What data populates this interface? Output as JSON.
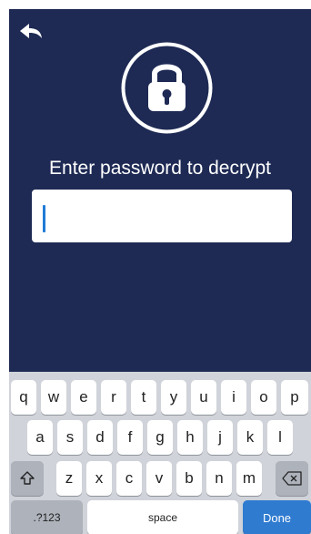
{
  "header": {
    "back_icon": "back-arrow-icon",
    "lock_icon": "lock-icon"
  },
  "prompt": "Enter password to decrypt",
  "password": {
    "value": "",
    "placeholder": ""
  },
  "keyboard": {
    "row1": [
      "q",
      "w",
      "e",
      "r",
      "t",
      "y",
      "u",
      "i",
      "o",
      "p"
    ],
    "row2": [
      "a",
      "s",
      "d",
      "f",
      "g",
      "h",
      "j",
      "k",
      "l"
    ],
    "row3": [
      "z",
      "x",
      "c",
      "v",
      "b",
      "n",
      "m"
    ],
    "shift_icon": "shift-icon",
    "delete_icon": "delete-icon",
    "numbers_label": ".?123",
    "space_label": "space",
    "done_label": "Done"
  },
  "colors": {
    "background": "#1e2a54",
    "accent": "#2f7bd0",
    "caret": "#1f7bd6"
  }
}
